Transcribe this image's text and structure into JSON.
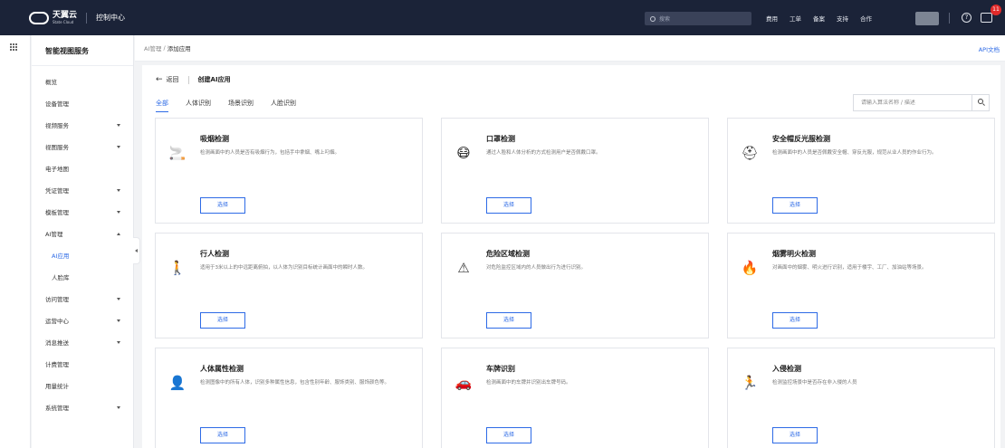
{
  "topbar": {
    "brand": "天翼云",
    "brand_sub": "State Cloud",
    "console": "控制中心",
    "search_placeholder": "搜索",
    "nav": [
      "费用",
      "工单",
      "备案",
      "支持",
      "合作"
    ],
    "help": "?",
    "badge": "11"
  },
  "sidebar": {
    "title": "智能视图服务",
    "items": [
      {
        "label": "概览",
        "caret": ""
      },
      {
        "label": "设备管理",
        "caret": ""
      },
      {
        "label": "视频服务",
        "caret": "down"
      },
      {
        "label": "视图服务",
        "caret": "down"
      },
      {
        "label": "电子地图",
        "caret": ""
      },
      {
        "label": "凭证管理",
        "caret": "down"
      },
      {
        "label": "模板管理",
        "caret": "down"
      },
      {
        "label": "AI管理",
        "caret": "up"
      },
      {
        "label": "AI应用",
        "caret": "",
        "sub": true,
        "active": true
      },
      {
        "label": "人脸库",
        "caret": "",
        "sub": true
      },
      {
        "label": "访问管理",
        "caret": "down"
      },
      {
        "label": "运营中心",
        "caret": "down"
      },
      {
        "label": "消息推送",
        "caret": "down"
      },
      {
        "label": "计费管理",
        "caret": ""
      },
      {
        "label": "用量统计",
        "caret": ""
      },
      {
        "label": "系统管理",
        "caret": "down"
      }
    ]
  },
  "breadcrumb": {
    "parent": "AI管理",
    "separator": " / ",
    "current": "添加应用",
    "api_doc": "API文档"
  },
  "header": {
    "back": "返回",
    "title": "创建AI应用"
  },
  "tabs": [
    "全部",
    "人体识别",
    "场景识别",
    "人脸识别"
  ],
  "search": {
    "placeholder": "请输入算法名称 / 描述"
  },
  "cards": [
    {
      "icon": "smoking-icon",
      "glyph": "🚬",
      "title": "吸烟检测",
      "desc": "检测画面中的人员是否有吸烟行为，包括手中拿烟、嘴上叼烟。",
      "button": "选择"
    },
    {
      "icon": "mask-icon",
      "glyph": "😷",
      "title": "口罩检测",
      "desc": "通过人脸和人体分析的方式检测用户是否佩戴口罩。",
      "button": "选择"
    },
    {
      "icon": "helmet-icon",
      "glyph": "⛑",
      "title": "安全帽反光服检测",
      "desc": "检测画面中的人员是否佩戴安全帽、穿反光服，规范从业人员的作业行为。",
      "button": "选择"
    },
    {
      "icon": "pedestrian-icon",
      "glyph": "🚶",
      "title": "行人检测",
      "desc": "适用于3米以上的中远距离俯拍，以人体为识别目标统计画面中的瞬时人数。",
      "button": "选择"
    },
    {
      "icon": "warning-icon",
      "glyph": "⚠",
      "title": "危险区域检测",
      "desc": "对危险监控区域内的人员做出行为进行识别。",
      "button": "选择"
    },
    {
      "icon": "fire-icon",
      "glyph": "🔥",
      "title": "烟雾明火检测",
      "desc": "对画面中的烟雾、明火进行识别，适用于楼宇、工厂、加油站等场景。",
      "button": "选择"
    },
    {
      "icon": "body-attribute-icon",
      "glyph": "👤",
      "title": "人体属性检测",
      "desc": "检测图像中的所有人体，识别多种属性信息，包含性别年龄、服饰类别、服饰颜色等。",
      "button": "选择"
    },
    {
      "icon": "car-icon",
      "glyph": "🚗",
      "title": "车牌识别",
      "desc": "检测画面中的车牌并识别出车牌号码。",
      "button": "选择"
    },
    {
      "icon": "intrusion-icon",
      "glyph": "🏃",
      "title": "入侵检测",
      "desc": "检测监控场景中是否存在非入侵的人员",
      "button": "选择"
    }
  ]
}
